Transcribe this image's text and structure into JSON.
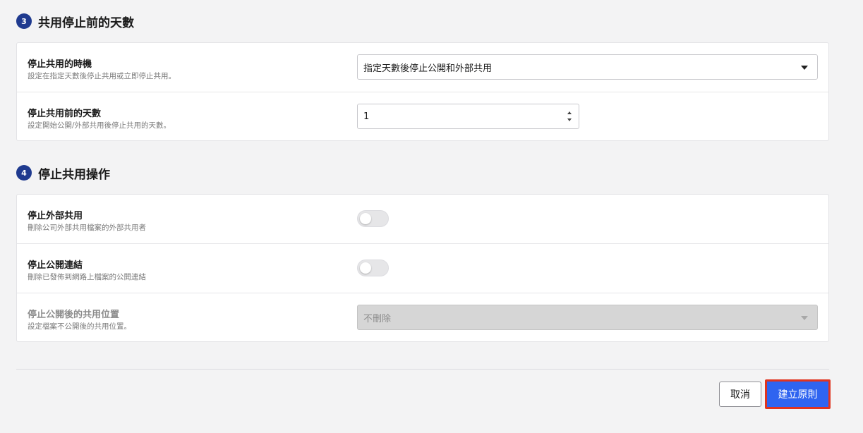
{
  "section3": {
    "step": "3",
    "title": "共用停止前的天數",
    "timing": {
      "label": "停止共用的時機",
      "desc": "設定在指定天數後停止共用或立即停止共用。",
      "selected": "指定天數後停止公開和外部共用"
    },
    "days": {
      "label": "停止共用前的天數",
      "desc": "設定開始公開/外部共用後停止共用的天數。",
      "value": "1"
    }
  },
  "section4": {
    "step": "4",
    "title": "停止共用操作",
    "external": {
      "label": "停止外部共用",
      "desc": "刪除公司外部共用檔案的外部共用者",
      "enabled": false
    },
    "public_link": {
      "label": "停止公開連結",
      "desc": "刪除已發佈到網路上檔案的公開連結",
      "enabled": false
    },
    "location": {
      "label": "停止公開後的共用位置",
      "desc": "設定檔案不公開後的共用位置。",
      "selected": "不刪除"
    }
  },
  "footer": {
    "cancel_label": "取消",
    "create_label": "建立原則"
  }
}
